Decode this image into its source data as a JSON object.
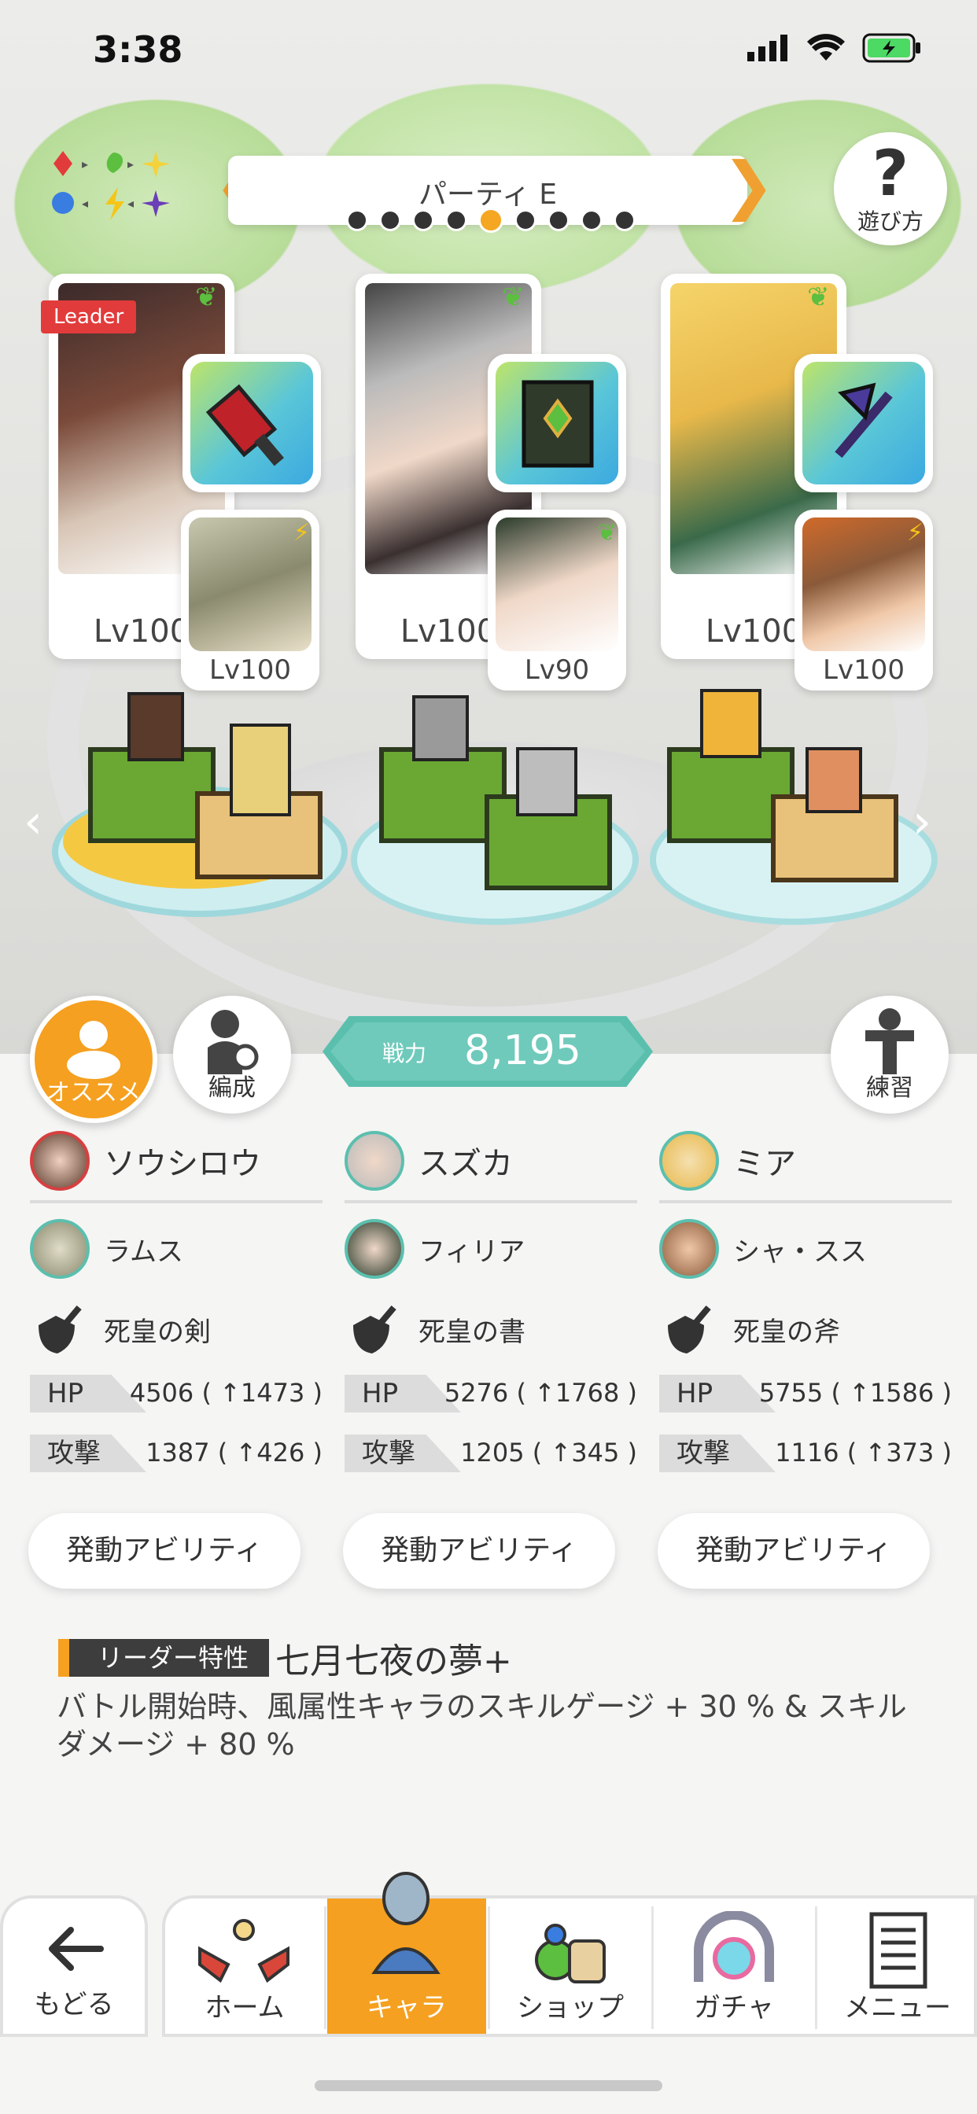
{
  "status_bar": {
    "time": "3:38"
  },
  "header": {
    "party_name": "パーティ E",
    "prev_arrow": "❮",
    "next_arrow": "❯",
    "page_count": 9,
    "active_page": 5,
    "help_label": "遊び方",
    "help_glyph": "?"
  },
  "party": {
    "leader_tag": "Leader",
    "characters": [
      {
        "main_level": "Lv100",
        "sub_level": "Lv100"
      },
      {
        "main_level": "Lv100",
        "sub_level": "Lv90"
      },
      {
        "main_level": "Lv100",
        "sub_level": "Lv100"
      }
    ]
  },
  "actions": {
    "recommend_label": "オススメ",
    "formation_label": "編成",
    "practice_label": "練習",
    "power_label": "戦力",
    "power_value": "8,195"
  },
  "columns": [
    {
      "main_name": "ソウシロウ",
      "sub_name": "ラムス",
      "weapon": "死皇の剣",
      "hp_label": "HP",
      "hp_value": "4506 ( ↑1473 )",
      "atk_label": "攻撃",
      "atk_value": "1387 ( ↑426 )",
      "ability_label": "発動アビリティ"
    },
    {
      "main_name": "スズカ",
      "sub_name": "フィリア",
      "weapon": "死皇の書",
      "hp_label": "HP",
      "hp_value": "5276 ( ↑1768 )",
      "atk_label": "攻撃",
      "atk_value": "1205 ( ↑345 )",
      "ability_label": "発動アビリティ"
    },
    {
      "main_name": "ミア",
      "sub_name": "シャ・スス",
      "weapon": "死皇の斧",
      "hp_label": "HP",
      "hp_value": "5755 ( ↑1586 )",
      "atk_label": "攻撃",
      "atk_value": "1116 ( ↑373 )",
      "ability_label": "発動アビリティ"
    }
  ],
  "leader_trait": {
    "tag": "リーダー特性",
    "name": "七月七夜の夢+",
    "description": "バトル開始時、風属性キャラのスキルゲージ + 30 % & スキルダメージ + 80 %"
  },
  "nav": {
    "back": "もどる",
    "home": "ホーム",
    "chara": "キャラ",
    "shop": "ショップ",
    "gacha": "ガチャ",
    "menu": "メニュー"
  },
  "colors": {
    "accent": "#f5a020",
    "teal": "#5bbfae",
    "wind": "#5cbf3f",
    "thunder": "#f5c518"
  }
}
